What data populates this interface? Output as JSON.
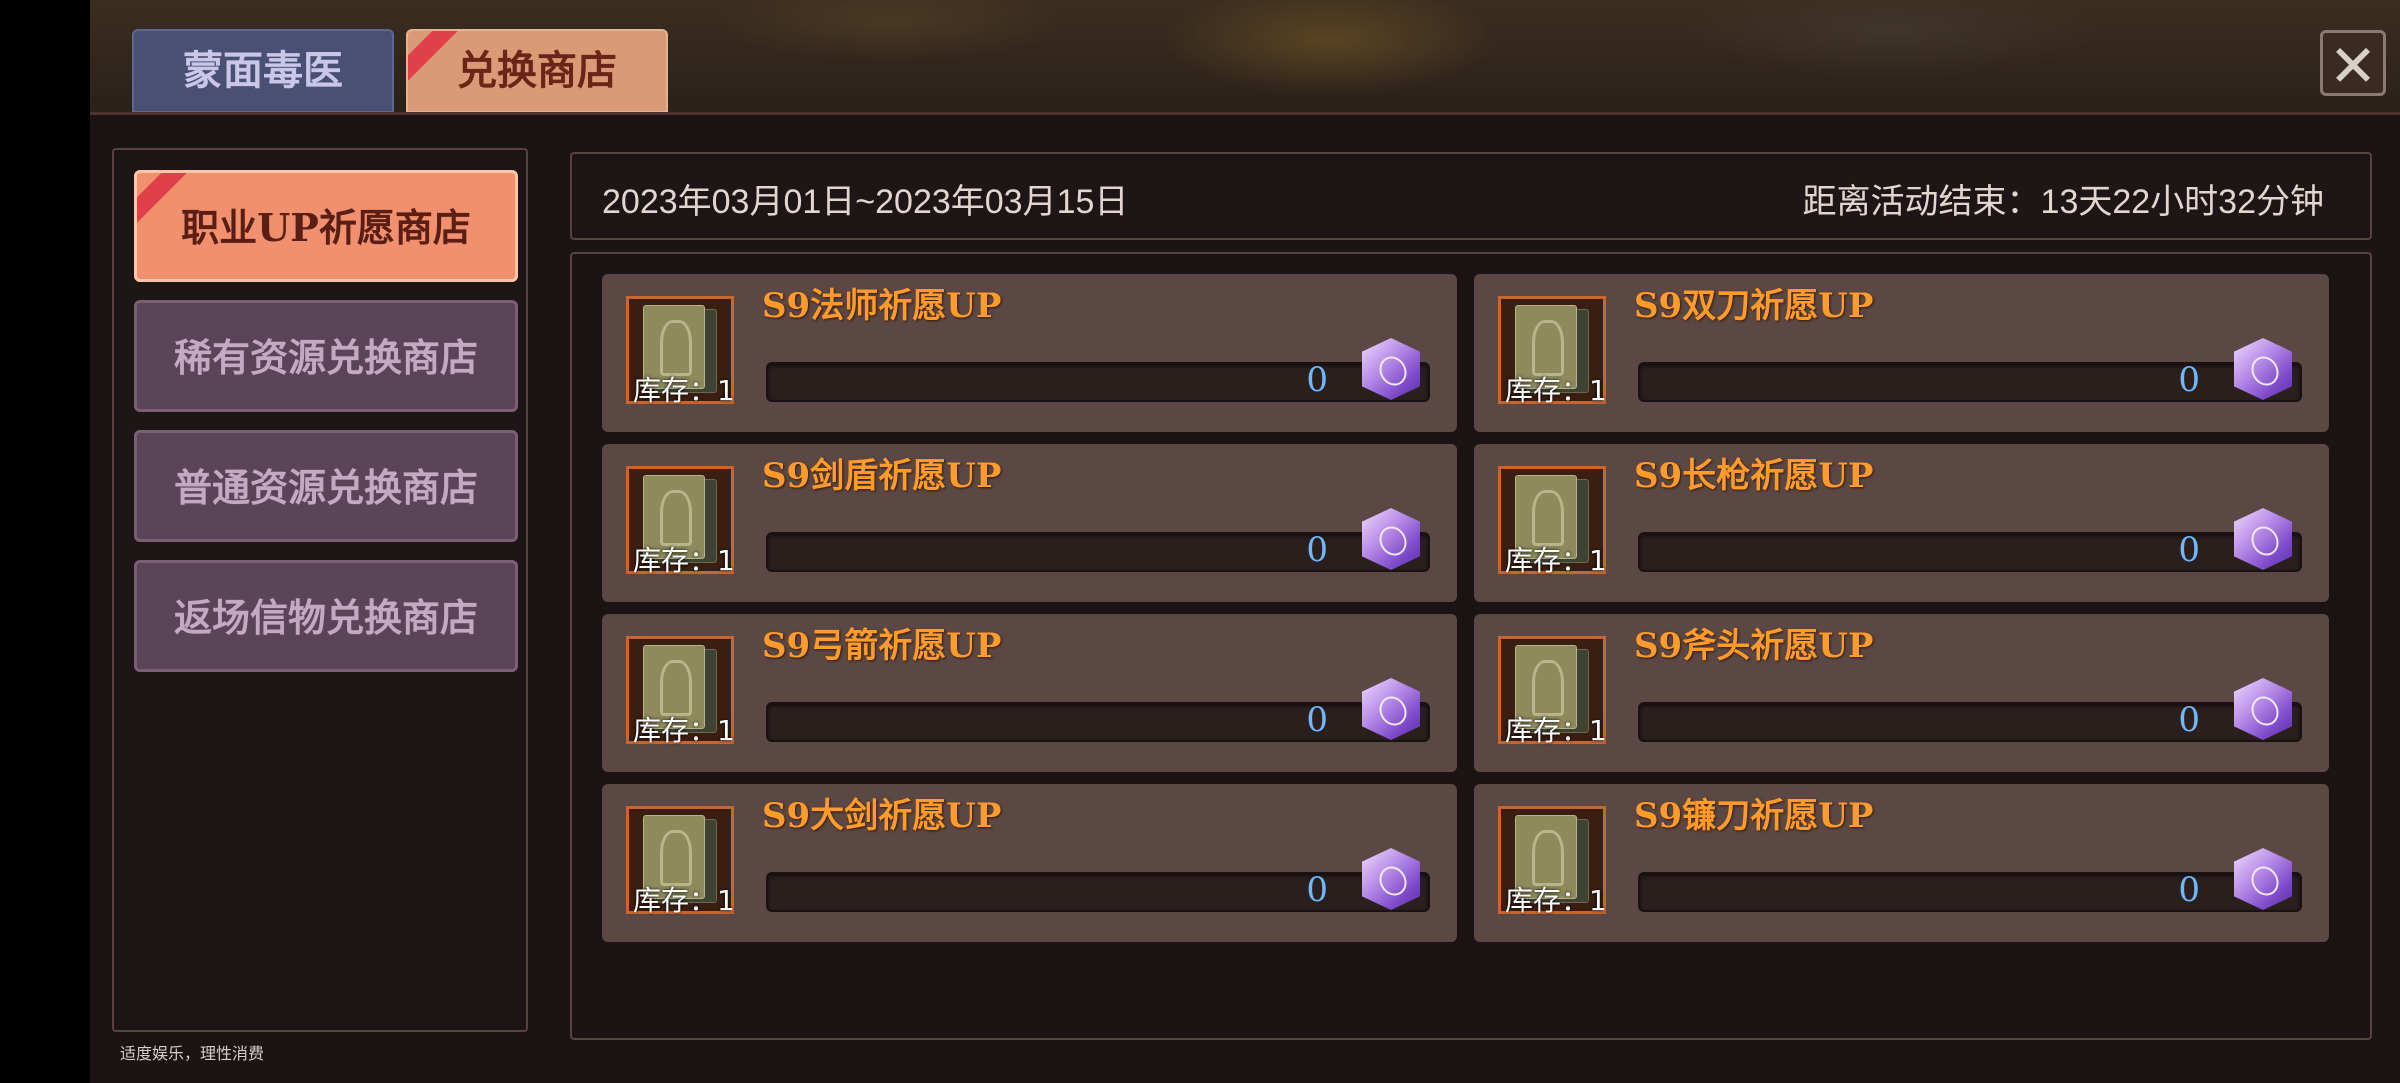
{
  "tabs": [
    {
      "label": "蒙面毒医",
      "active": false
    },
    {
      "label": "兑换商店",
      "active": true
    }
  ],
  "close_icon": "close-icon",
  "sidebar": {
    "items": [
      {
        "label": "职业UP祈愿商店",
        "active": true
      },
      {
        "label": "稀有资源兑换商店",
        "active": false
      },
      {
        "label": "普通资源兑换商店",
        "active": false
      },
      {
        "label": "返场信物兑换商店",
        "active": false
      }
    ]
  },
  "disclaimer": "适度娱乐，理性消费",
  "event": {
    "date_range": "2023年03月01日~2023年03月15日",
    "countdown": "距离活动结束：13天22小时32分钟"
  },
  "shop_items": [
    {
      "title": "S9法师祈愿UP",
      "stock": "库存：1",
      "price": "0",
      "icon": "card-pack-icon"
    },
    {
      "title": "S9双刀祈愿UP",
      "stock": "库存：1",
      "price": "0",
      "icon": "card-pack-icon"
    },
    {
      "title": "S9剑盾祈愿UP",
      "stock": "库存：1",
      "price": "0",
      "icon": "card-pack-icon"
    },
    {
      "title": "S9长枪祈愿UP",
      "stock": "库存：1",
      "price": "0",
      "icon": "card-pack-icon"
    },
    {
      "title": "S9弓箭祈愿UP",
      "stock": "库存：1",
      "price": "0",
      "icon": "card-pack-icon"
    },
    {
      "title": "S9斧头祈愿UP",
      "stock": "库存：1",
      "price": "0",
      "icon": "card-pack-icon"
    },
    {
      "title": "S9大剑祈愿UP",
      "stock": "库存：1",
      "price": "0",
      "icon": "card-pack-icon"
    },
    {
      "title": "S9镰刀祈愿UP",
      "stock": "库存：1",
      "price": "0",
      "icon": "card-pack-icon"
    }
  ],
  "colors": {
    "accent": "#f0906e",
    "title_orange": "#ff9b2a",
    "price_blue": "#6fb8ff",
    "panel": "#5b4744"
  }
}
